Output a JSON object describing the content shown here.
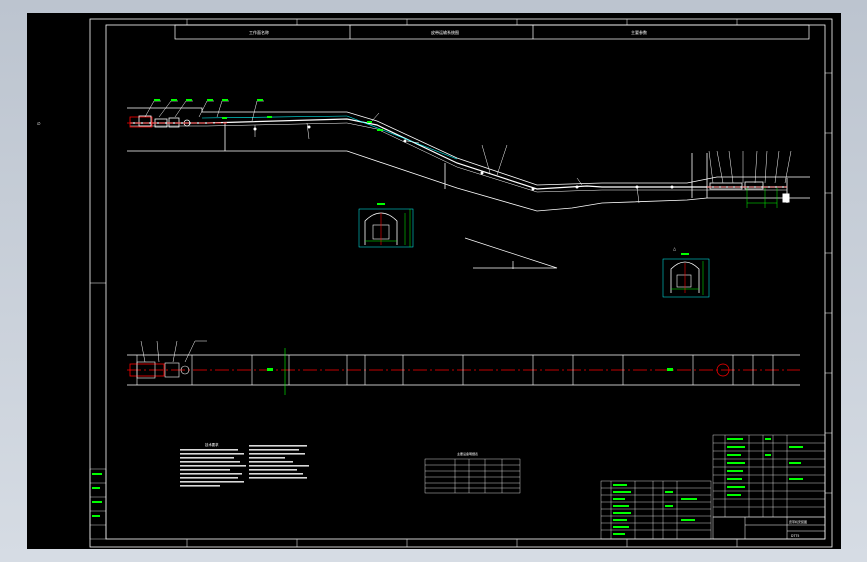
{
  "title_bar": {
    "col1": "工作面名称",
    "col2": "皮带运输系统图",
    "col3": "主要参数"
  },
  "tables": {
    "tech_table_title": "技术要求",
    "parts_table_title": "主要设备明细表",
    "title_block_name": "皮带机安装图",
    "drawing_no": "DT75"
  },
  "colors": {
    "frame": "#ffffff",
    "dimension": "#00ff00",
    "leader": "#ffffff",
    "centerline": "#ff0000",
    "annotation": "#00ffff",
    "background": "#000000"
  }
}
